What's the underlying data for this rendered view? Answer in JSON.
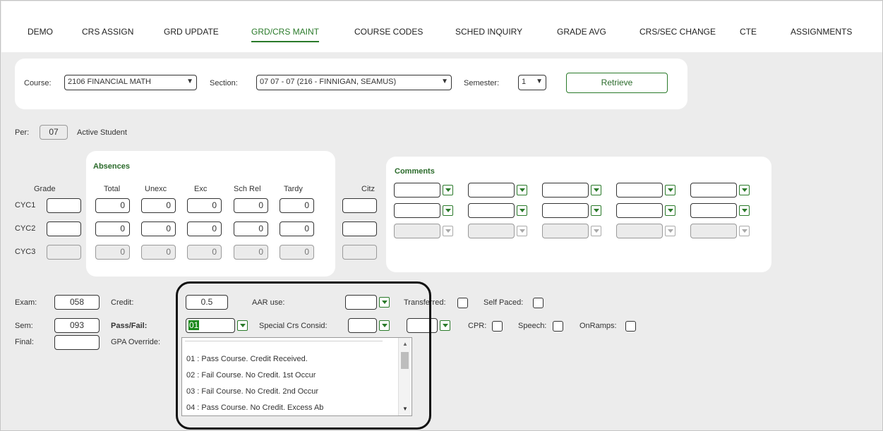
{
  "nav": {
    "items": [
      "DEMO",
      "CRS ASSIGN",
      "GRD UPDATE",
      "GRD/CRS MAINT",
      "COURSE CODES",
      "SCHED INQUIRY",
      "GRADE AVG",
      "CRS/SEC CHANGE",
      "CTE",
      "ASSIGNMENTS"
    ],
    "active": "GRD/CRS MAINT"
  },
  "filter": {
    "course_label": "Course:",
    "course_value": "2106 FINANCIAL MATH",
    "section_label": "Section:",
    "section_value": "07 07 - 07 (216 - FINNIGAN, SEAMUS)",
    "semester_label": "Semester:",
    "semester_value": "1",
    "retrieve_label": "Retrieve"
  },
  "student": {
    "per_label": "Per:",
    "per_value": "07",
    "status": "Active Student"
  },
  "grades": {
    "grade_header": "Grade",
    "absences_title": "Absences",
    "absence_headers": [
      "Total",
      "Unexc",
      "Exc",
      "Sch Rel",
      "Tardy"
    ],
    "citz_header": "Citz",
    "cycles": [
      {
        "label": "CYC1",
        "absences": [
          "0",
          "0",
          "0",
          "0",
          "0"
        ]
      },
      {
        "label": "CYC2",
        "absences": [
          "0",
          "0",
          "0",
          "0",
          "0"
        ]
      },
      {
        "label": "CYC3",
        "absences": [
          "0",
          "0",
          "0",
          "0",
          "0"
        ]
      }
    ]
  },
  "comments": {
    "title": "Comments"
  },
  "exam": {
    "exam_label": "Exam:",
    "exam_value": "058",
    "sem_label": "Sem:",
    "sem_value": "093",
    "final_label": "Final:",
    "credit_label": "Credit:",
    "credit_value": "0.5",
    "passfail_label": "Pass/Fail:",
    "passfail_value": "01",
    "gpa_label": "GPA Override:",
    "aar_label": "AAR use:",
    "special_label": "Special Crs Consid:",
    "transferred_label": "Transferred:",
    "selfpaced_label": "Self Paced:",
    "cpr_label": "CPR:",
    "speech_label": "Speech:",
    "onramps_label": "OnRamps:"
  },
  "passfail_options": [
    "01 : Pass Course. Credit Received.",
    "02 : Fail Course. No Credit. 1st Occur",
    "03 : Fail Course. No Credit. 2nd Occur",
    "04 : Pass Course. No Credit. Excess Ab"
  ],
  "colors": {
    "accent": "#2a7a2a",
    "page_bg": "#ececec",
    "card_bg": "#ffffff",
    "selected_bg": "#1b8a1b"
  },
  "icons": {
    "select_chevron": "chevron-down-icon",
    "dropdown_toggle": "dropdown-arrow-icon"
  }
}
